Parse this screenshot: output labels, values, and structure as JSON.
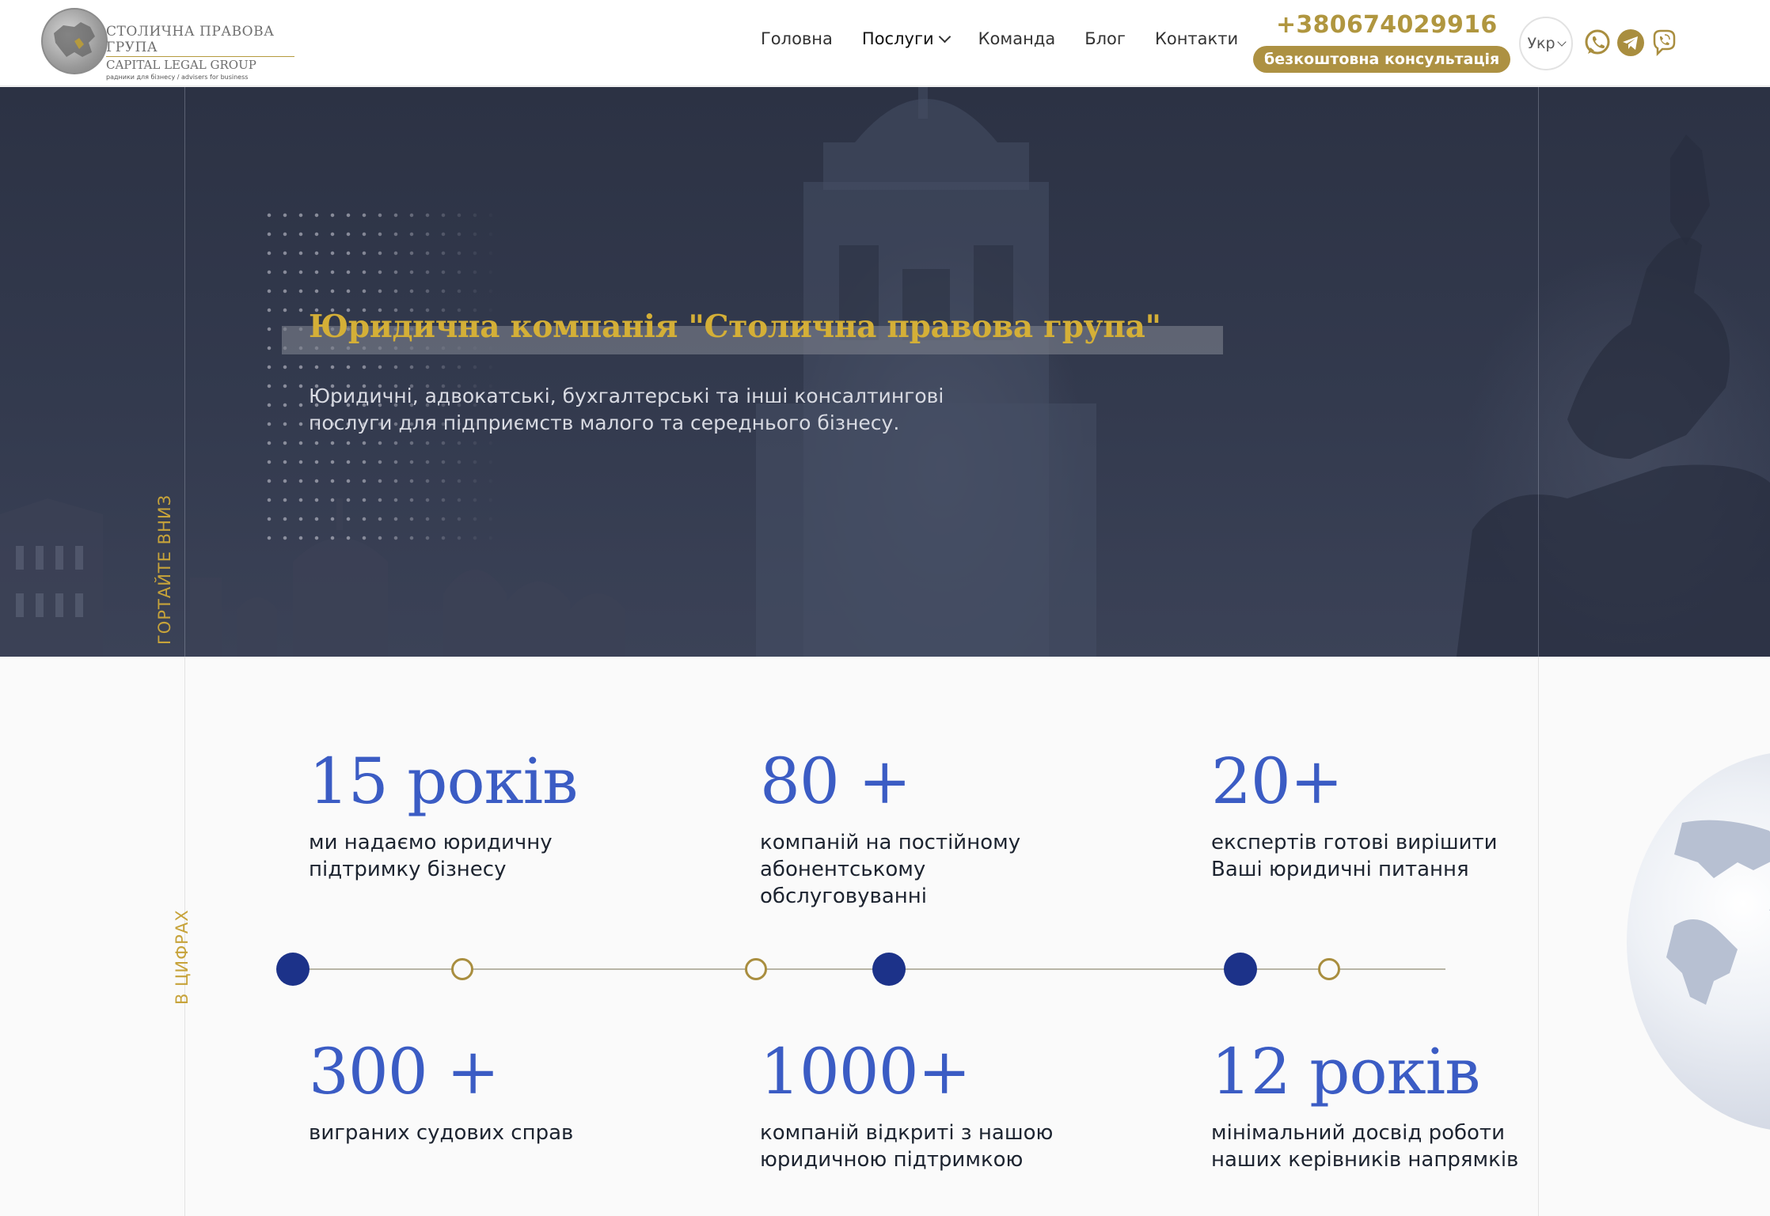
{
  "header": {
    "logo": {
      "line1": "СТОЛИЧНА ПРАВОВА ГРУПА",
      "line2": "CAPITAL LEGAL GROUP",
      "line3": "радники для бізнесу / advisers for business"
    },
    "nav": [
      {
        "label": "Головна"
      },
      {
        "label": "Послуги",
        "has_dropdown": true
      },
      {
        "label": "Команда"
      },
      {
        "label": "Блог"
      },
      {
        "label": "Контакти"
      }
    ],
    "phone": "+380674029916",
    "consult_label": "безкоштовна консультація",
    "language": "Укр",
    "socials": [
      "whatsapp-icon",
      "telegram-icon",
      "viber-icon"
    ],
    "colors": {
      "gold": "#ad9142",
      "whatsapp": "#b0963f"
    }
  },
  "hero": {
    "title": "Юридична компанія \"Столична правова група\"",
    "subtitle": "Юридичні, адвокатські, бухгалтерські та інші консалтингові послуги для підприємств малого та середнього бізнесу.",
    "scroll_label": "ГОРТАЙТЕ ВНИЗ"
  },
  "stats": {
    "section_label": "В ЦИФРАХ",
    "items": [
      {
        "number": "15 років",
        "text": "ми надаємо юридичну підтримку бізнесу"
      },
      {
        "number": "80 +",
        "text": "компаній на постійному абонентському обслуговуванні"
      },
      {
        "number": "20+",
        "text": "експертів готові вирішити Ваші юридичні питання"
      },
      {
        "number": "300 +",
        "text": "виграних судових справ"
      },
      {
        "number": "1000+",
        "text": "компаній відкриті з нашою юридичною підтримкою"
      },
      {
        "number": "12 років",
        "text": "мінімальний досвід роботи наших керівників напрямків"
      }
    ],
    "colors": {
      "number": "#3b5cc4",
      "dot": "#1c3289",
      "ring": "#a98e3f"
    }
  }
}
